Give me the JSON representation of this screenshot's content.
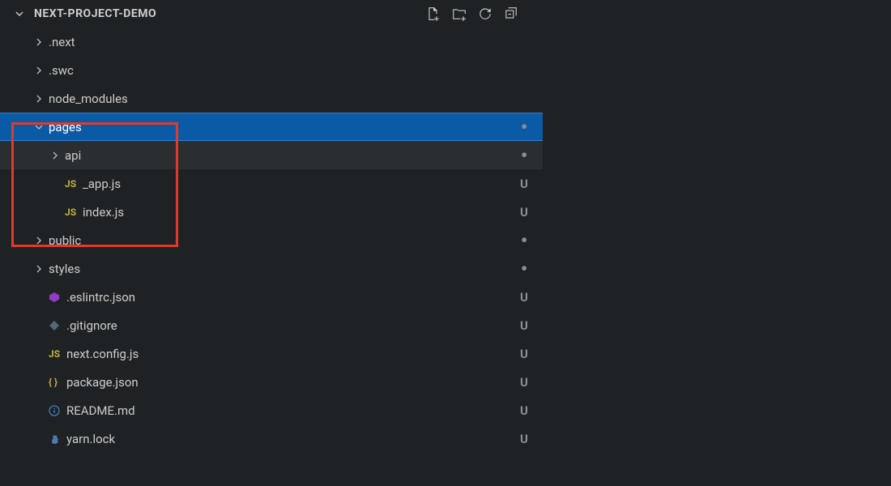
{
  "header": {
    "title": "NEXT-PROJECT-DEMO"
  },
  "tree": [
    {
      "type": "folder",
      "label": ".next",
      "indent": 1,
      "expanded": false,
      "status": ""
    },
    {
      "type": "folder",
      "label": ".swc",
      "indent": 1,
      "expanded": false,
      "status": ""
    },
    {
      "type": "folder",
      "label": "node_modules",
      "indent": 1,
      "expanded": false,
      "status": ""
    },
    {
      "type": "folder",
      "label": "pages",
      "indent": 1,
      "expanded": true,
      "status": "dot",
      "selected": true
    },
    {
      "type": "folder",
      "label": "api",
      "indent": 2,
      "expanded": false,
      "status": "dot",
      "active": true
    },
    {
      "type": "file",
      "label": "_app.js",
      "indent": 2,
      "icon": "js",
      "status": "U"
    },
    {
      "type": "file",
      "label": "index.js",
      "indent": 2,
      "icon": "js",
      "status": "U"
    },
    {
      "type": "folder",
      "label": "public",
      "indent": 1,
      "expanded": false,
      "status": "dot"
    },
    {
      "type": "folder",
      "label": "styles",
      "indent": 1,
      "expanded": false,
      "status": "dot"
    },
    {
      "type": "file",
      "label": ".eslintrc.json",
      "indent": 1,
      "icon": "eslint",
      "status": "U"
    },
    {
      "type": "file",
      "label": ".gitignore",
      "indent": 1,
      "icon": "git",
      "status": "U"
    },
    {
      "type": "file",
      "label": "next.config.js",
      "indent": 1,
      "icon": "js",
      "status": "U"
    },
    {
      "type": "file",
      "label": "package.json",
      "indent": 1,
      "icon": "json",
      "status": "U"
    },
    {
      "type": "file",
      "label": "README.md",
      "indent": 1,
      "icon": "info",
      "status": "U"
    },
    {
      "type": "file",
      "label": "yarn.lock",
      "indent": 1,
      "icon": "yarn",
      "status": "U"
    }
  ]
}
